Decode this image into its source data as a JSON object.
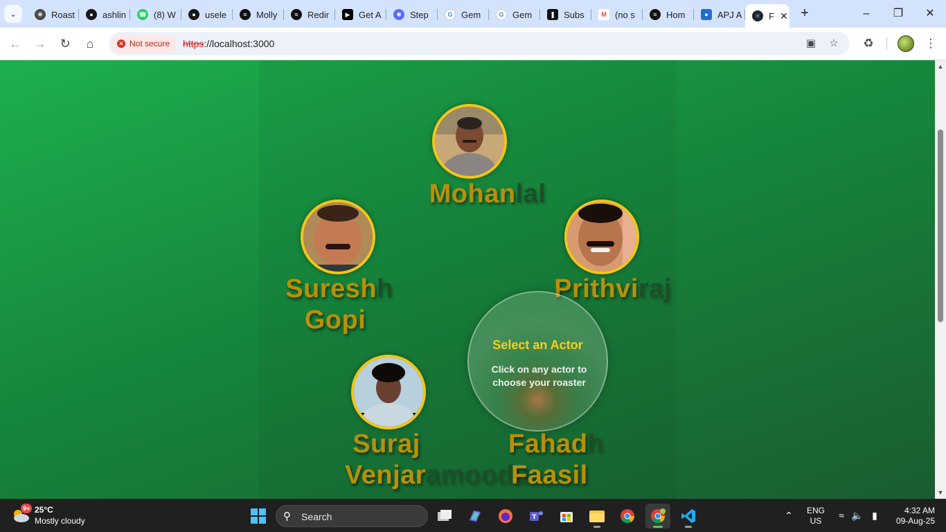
{
  "browser": {
    "tabs": [
      {
        "label": "Roast",
        "favicon": "openai-icon",
        "color": "#4a4a4a"
      },
      {
        "label": "ashlin",
        "favicon": "github-icon",
        "color": "#181717"
      },
      {
        "label": "(8) W",
        "favicon": "whatsapp-icon",
        "color": "#25d366"
      },
      {
        "label": "usele",
        "favicon": "github-icon",
        "color": "#181717"
      },
      {
        "label": "Molly",
        "favicon": "spotify-icon",
        "color": "#111111"
      },
      {
        "label": "Redir",
        "favicon": "spotify-icon",
        "color": "#111111"
      },
      {
        "label": "Get A",
        "favicon": "cursor-icon",
        "color": "#000000"
      },
      {
        "label": "Step",
        "favicon": "stepfun-icon",
        "color": "#5b6cff"
      },
      {
        "label": "Gem",
        "favicon": "google-icon",
        "color": "#ffffff"
      },
      {
        "label": "Gem",
        "favicon": "google-icon",
        "color": "#ffffff"
      },
      {
        "label": "Subs",
        "favicon": "substack-icon",
        "color": "#111111"
      },
      {
        "label": "(no s",
        "favicon": "gmail-icon",
        "color": "#ffffff"
      },
      {
        "label": "Hom",
        "favicon": "spotify-icon",
        "color": "#111111"
      },
      {
        "label": "APJ A",
        "favicon": "edge-icon",
        "color": "#1f6fd1"
      },
      {
        "label": "F",
        "favicon": "react-icon",
        "color": "#20232a",
        "active": true
      }
    ],
    "security_chip": "Not secure",
    "url_protocol": "https",
    "url_rest": "://localhost:3000"
  },
  "page": {
    "actors": [
      {
        "id": "mohanlal",
        "name_strong": "Mohan",
        "name_faded": "lal"
      },
      {
        "id": "suresh-gopi",
        "line1_strong": "Suresh",
        "line1_faded": "h",
        "line2_strong": "Gopi"
      },
      {
        "id": "prithviraj",
        "name_strong": "Prithvi",
        "name_faded": "raj"
      },
      {
        "id": "suraj",
        "line1_strong": "Suraj",
        "line2_strong": "Venjar",
        "line2_faded": "amoodu"
      },
      {
        "id": "fahad",
        "line1_strong": "Fahad",
        "line1_faded": "h",
        "line2_strong": "Faasil"
      }
    ],
    "select_title": "Select an Actor",
    "select_subtitle": "Click on any actor to choose your roaster"
  },
  "taskbar": {
    "weather_badge": "9+",
    "temperature": "25°C",
    "condition": "Mostly cloudy",
    "search_label": "Search",
    "lang_line1": "ENG",
    "lang_line2": "US",
    "time": "4:32 AM",
    "date": "09-Aug-25"
  }
}
